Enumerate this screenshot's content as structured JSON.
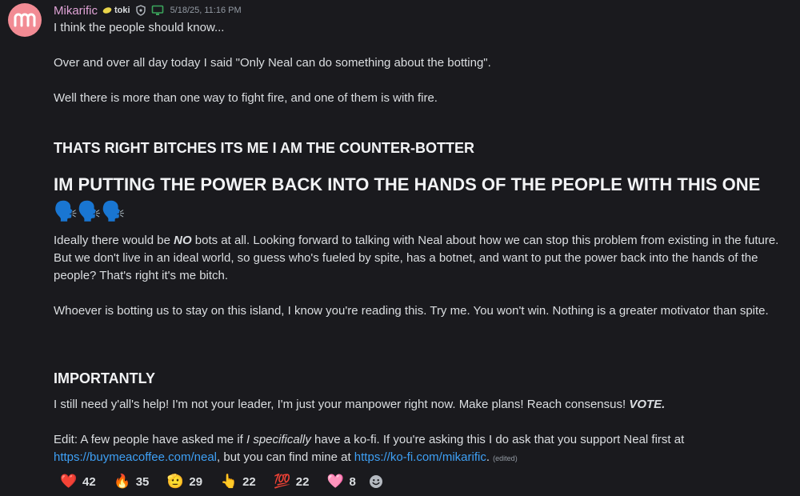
{
  "author": {
    "name": "Mikarific",
    "tag": "toki",
    "timestamp": "5/18/25, 11:16 PM"
  },
  "message": {
    "p1": "I think the people should know...",
    "p2": "Over and over all day today I said \"Only Neal can do something about the botting\".",
    "p3": "Well there is more than one way to fight fire, and one of them is with fire.",
    "h_counter": "THATS RIGHT BITCHES ITS ME I AM THE COUNTER-BOTTER",
    "h_power": "IM PUTTING THE POWER BACK INTO THE HANDS OF THE PEOPLE WITH THIS ONE",
    "speaking_emoji": "🗣️🗣️🗣️",
    "p4_a": "Ideally there would be ",
    "p4_no": "NO",
    "p4_b": " bots at all. Looking forward to talking with Neal about how we can stop this problem from existing in the future. But we don't live in an ideal world, so guess who's fueled by spite, has a botnet, and want to put the power back into the hands of the people? That's right it's me bitch.",
    "p5": "Whoever is botting us to stay on this island, I know you're reading this. Try me. You won't win. Nothing is a greater motivator than spite.",
    "h_importantly": "IMPORTANTLY",
    "p6_a": "I still need y'all's help! I'm not your leader, I'm just your manpower right now. Make plans! Reach consensus! ",
    "p6_vote": "VOTE.",
    "p7_a": "Edit: A few people have asked me if ",
    "p7_italic": "I specifically",
    "p7_b": " have a ko-fi. If you're asking this I do ask that you support Neal first at",
    "link1": "https://buymeacoffee.com/neal",
    "p7_c": ", but you can find mine at ",
    "link2": "https://ko-fi.com/mikarific",
    "p7_d": ".",
    "edited": "(edited)"
  },
  "reactions": [
    {
      "emoji": "❤️",
      "count": "42"
    },
    {
      "emoji": "🔥",
      "count": "35"
    },
    {
      "emoji": "🫡",
      "count": "29"
    },
    {
      "emoji": "👆",
      "count": "22"
    },
    {
      "emoji": "💯",
      "count": "22"
    },
    {
      "emoji": "🩷",
      "count": "8"
    }
  ],
  "colors": {
    "background": "#1a1a1e",
    "username": "#e0a3d6",
    "link": "#3ea0f5",
    "avatar": "#f28b94"
  }
}
